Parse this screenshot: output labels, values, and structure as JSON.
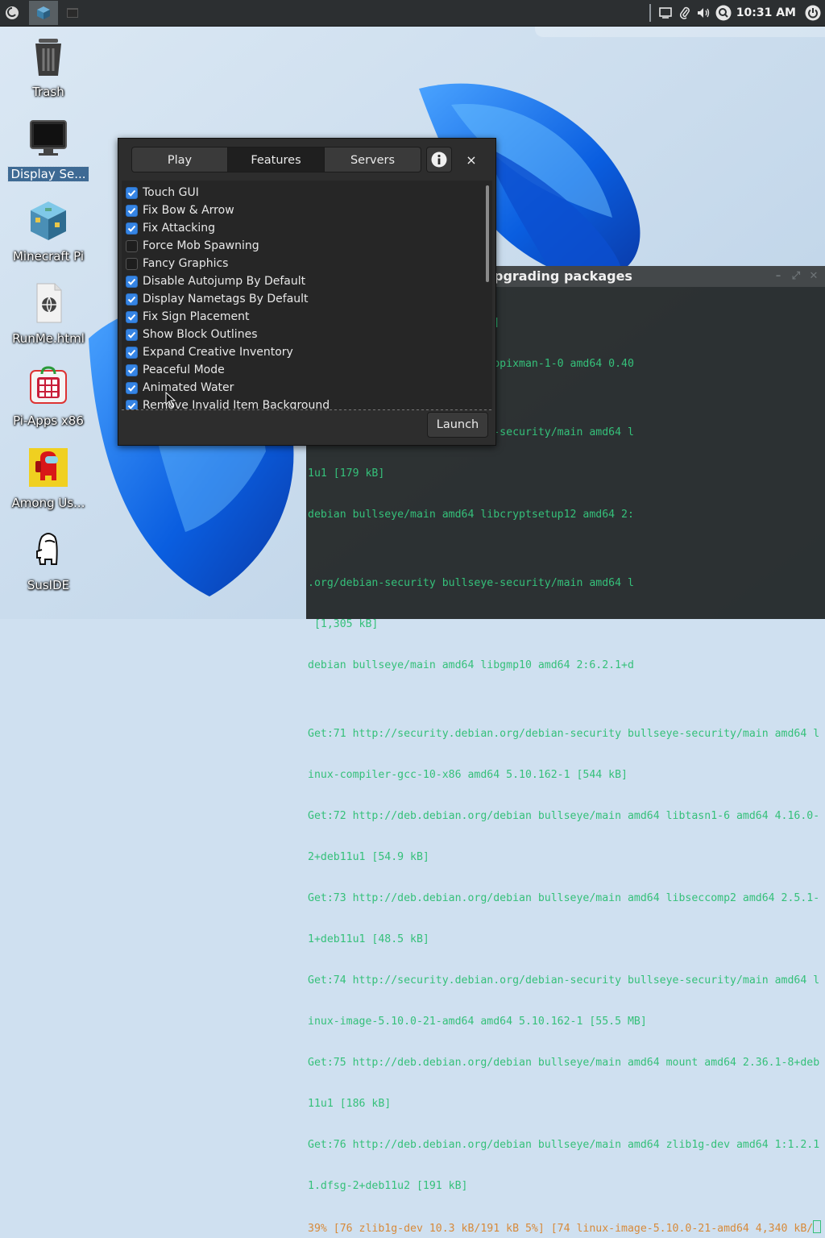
{
  "colors": {
    "accent": "#3584e4",
    "terminal_text": "#35c07a",
    "terminal_status": "#d78a3a",
    "panel": "#2c2f31"
  },
  "panel": {
    "menu_icon": "debian-menu-icon",
    "tasks": [
      {
        "icon": "minecraft-block-icon"
      },
      {
        "icon": "terminal-icon"
      }
    ],
    "tray_icons": [
      "screen-icon",
      "paperclip-icon",
      "volume-icon",
      "search-icon"
    ],
    "clock": "10:31 AM",
    "power_icon": "power-icon"
  },
  "desktop": {
    "icons": [
      {
        "label": "Trash",
        "icon": "trash-icon"
      },
      {
        "label": "Display Se...",
        "icon": "monitor-icon",
        "selected": true
      },
      {
        "label": "Minecraft Pi",
        "icon": "minecraft-block-icon"
      },
      {
        "label": "RunMe.html",
        "icon": "html-file-icon"
      },
      {
        "label": "Pi-Apps x86",
        "icon": "pi-apps-icon"
      },
      {
        "label": "Among Us...",
        "icon": "among-us-icon"
      },
      {
        "label": "SusIDE",
        "icon": "sus-ghost-icon"
      }
    ]
  },
  "launcher": {
    "tabs": [
      {
        "label": "Play",
        "active": false
      },
      {
        "label": "Features",
        "active": true
      },
      {
        "label": "Servers",
        "active": false
      }
    ],
    "info_icon": "info-icon",
    "close_label": "×",
    "features": [
      {
        "label": "Touch GUI",
        "checked": true
      },
      {
        "label": "Fix Bow & Arrow",
        "checked": true
      },
      {
        "label": "Fix Attacking",
        "checked": true
      },
      {
        "label": "Force Mob Spawning",
        "checked": false
      },
      {
        "label": "Fancy Graphics",
        "checked": false
      },
      {
        "label": "Disable Autojump By Default",
        "checked": true
      },
      {
        "label": "Display Nametags By Default",
        "checked": true
      },
      {
        "label": "Fix Sign Placement",
        "checked": true
      },
      {
        "label": "Show Block Outlines",
        "checked": true
      },
      {
        "label": "Expand Creative Inventory",
        "checked": true
      },
      {
        "label": "Peaceful Mode",
        "checked": true
      },
      {
        "label": "Animated Water",
        "checked": true
      },
      {
        "label": "Remove Invalid Item Background",
        "checked": true
      }
    ],
    "launch_label": "Launch"
  },
  "terminal": {
    "title": "Upgrading packages",
    "lines": [
      "64 2.38.5-1~deb11u1 [5,607 kB]",
      "debian bullseye/main amd64 libpixman-1-0 amd64 0.40",
      "",
      ".org/debian-security bullseye-security/main amd64 l",
      "1u1 [179 kB]",
      "debian bullseye/main amd64 libcryptsetup12 amd64 2:",
      "",
      ".org/debian-security bullseye-security/main amd64 l",
      " [1,305 kB]",
      "debian bullseye/main amd64 libgmp10 amd64 2:6.2.1+d",
      "",
      "Get:71 http://security.debian.org/debian-security bullseye-security/main amd64 l",
      "inux-compiler-gcc-10-x86 amd64 5.10.162-1 [544 kB]",
      "Get:72 http://deb.debian.org/debian bullseye/main amd64 libtasn1-6 amd64 4.16.0-",
      "2+deb11u1 [54.9 kB]",
      "Get:73 http://deb.debian.org/debian bullseye/main amd64 libseccomp2 amd64 2.5.1-",
      "1+deb11u1 [48.5 kB]",
      "Get:74 http://security.debian.org/debian-security bullseye-security/main amd64 l",
      "inux-image-5.10.0-21-amd64 amd64 5.10.162-1 [55.5 MB]",
      "Get:75 http://deb.debian.org/debian bullseye/main amd64 mount amd64 2.36.1-8+deb",
      "11u1 [186 kB]",
      "Get:76 http://deb.debian.org/debian bullseye/main amd64 zlib1g-dev amd64 1:1.2.1",
      "1.dfsg-2+deb11u2 [191 kB]"
    ],
    "status_line": "39% [76 zlib1g-dev 10.3 kB/191 kB 5%] [74 linux-image-5.10.0-21-amd64 4,340 kB/"
  }
}
